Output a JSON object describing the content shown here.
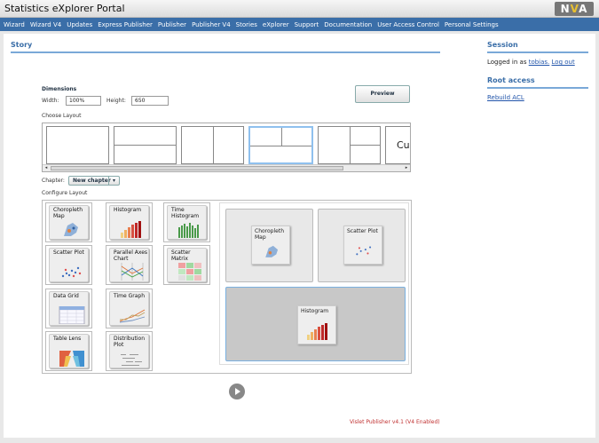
{
  "header": {
    "title": "Statistics eXplorer Portal",
    "logo": "NVA"
  },
  "nav": [
    "Wizard",
    "Wizard V4",
    "Updates",
    "Express Publisher",
    "Publisher",
    "Publisher V4",
    "Stories",
    "eXplorer",
    "Support",
    "Documentation",
    "User Access Control",
    "Personal Settings"
  ],
  "main": {
    "heading": "Story",
    "dimensions_label": "Dimensions",
    "width_label": "Width:",
    "width_value": "100%",
    "height_label": "Height:",
    "height_value": "650",
    "preview_label": "Preview",
    "choose_layout_label": "Choose Layout",
    "layout_partial_text": "Cu",
    "chapter_label": "Chapter:",
    "chapter_value": "New chapter",
    "configure_layout_label": "Configure Layout"
  },
  "visualizations": [
    {
      "label": "Choropleth Map",
      "icon": "map-icon"
    },
    {
      "label": "Histogram",
      "icon": "histogram-icon"
    },
    {
      "label": "Time Histogram",
      "icon": "time-histogram-icon"
    },
    {
      "label": "Scatter Plot",
      "icon": "scatter-plot-icon"
    },
    {
      "label": "Parallel Axes Chart",
      "icon": "parallel-axes-icon"
    },
    {
      "label": "Scatter Matrix",
      "icon": "scatter-matrix-icon"
    },
    {
      "label": "Data Grid",
      "icon": "data-grid-icon"
    },
    {
      "label": "Time Graph",
      "icon": "time-graph-icon"
    },
    {
      "label": "Table Lens",
      "icon": "table-lens-icon"
    },
    {
      "label": "Distribution Plot",
      "icon": "distribution-plot-icon"
    }
  ],
  "canvas": [
    {
      "label": "Choropleth Map"
    },
    {
      "label": "Scatter Plot"
    },
    {
      "label": "Histogram"
    }
  ],
  "sidebar": {
    "session_heading": "Session",
    "logged_in_prefix": "Logged in as",
    "username": "tobias.",
    "logout": "Log out",
    "root_heading": "Root access",
    "rebuild_acl": "Rebuild ACL"
  },
  "footer": "Vislet Publisher v4.1 (V4 Enabled)",
  "colors": {
    "nav": "#3a6ea8",
    "accent": "#7aa8d8",
    "footer": "#c03030"
  }
}
